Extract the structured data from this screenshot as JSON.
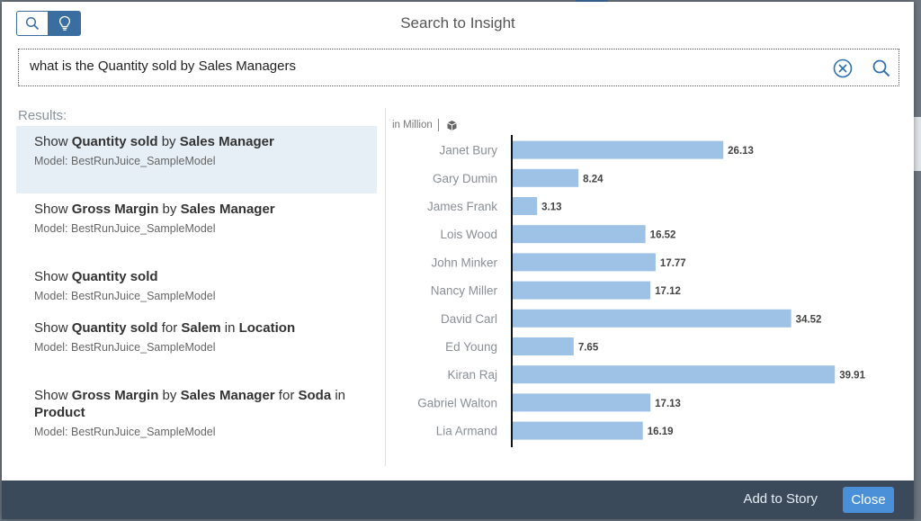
{
  "dialog": {
    "title": "Search to Insight"
  },
  "search": {
    "query": "what is the Quantity sold by Sales Managers"
  },
  "results": {
    "label": "Results:",
    "items": [
      {
        "segments": [
          [
            "Show ",
            false
          ],
          [
            "Quantity sold",
            true
          ],
          [
            " by ",
            false
          ],
          [
            "Sales Manager",
            true
          ]
        ],
        "model": "Model: BestRunJuice_SampleModel",
        "selected": true
      },
      {
        "segments": [
          [
            "Show ",
            false
          ],
          [
            "Gross Margin",
            true
          ],
          [
            " by ",
            false
          ],
          [
            "Sales Manager",
            true
          ]
        ],
        "model": "Model: BestRunJuice_SampleModel",
        "selected": false
      },
      {
        "segments": [
          [
            "Show ",
            false
          ],
          [
            "Quantity sold",
            true
          ]
        ],
        "model": "Model: BestRunJuice_SampleModel",
        "selected": false
      },
      {
        "segments": [
          [
            "Show ",
            false
          ],
          [
            "Quantity sold",
            true
          ],
          [
            " for ",
            false
          ],
          [
            "Salem",
            true
          ],
          [
            " in ",
            false
          ],
          [
            "Location",
            true
          ]
        ],
        "model": "Model: BestRunJuice_SampleModel",
        "selected": false
      },
      {
        "segments": [
          [
            "Show ",
            false
          ],
          [
            "Gross Margin",
            true
          ],
          [
            " by ",
            false
          ],
          [
            "Sales Manager",
            true
          ],
          [
            " for ",
            false
          ],
          [
            "Soda",
            true
          ],
          [
            " in ",
            false
          ],
          [
            "Product",
            true
          ]
        ],
        "model": "Model: BestRunJuice_SampleModel",
        "selected": false
      }
    ]
  },
  "chart_unit": "in Million",
  "chart_data": {
    "type": "bar",
    "orientation": "horizontal",
    "categories": [
      "Janet Bury",
      "Gary Dumin",
      "James Frank",
      "Lois Wood",
      "John Minker",
      "Nancy Miller",
      "David Carl",
      "Ed Young",
      "Kiran Raj",
      "Gabriel Walton",
      "Lia Armand"
    ],
    "values": [
      26.13,
      8.24,
      3.13,
      16.52,
      17.77,
      17.12,
      34.52,
      7.65,
      39.91,
      17.13,
      16.19
    ],
    "bar_color": "#9dc2e6",
    "xlim": [
      0,
      40
    ],
    "grid": false
  },
  "footer": {
    "add_to_story": "Add to Story",
    "close": "Close"
  },
  "colors": {
    "footer": "#3a4a5a",
    "accent": "#4a90d9",
    "selected_row": "#e6eef6"
  }
}
